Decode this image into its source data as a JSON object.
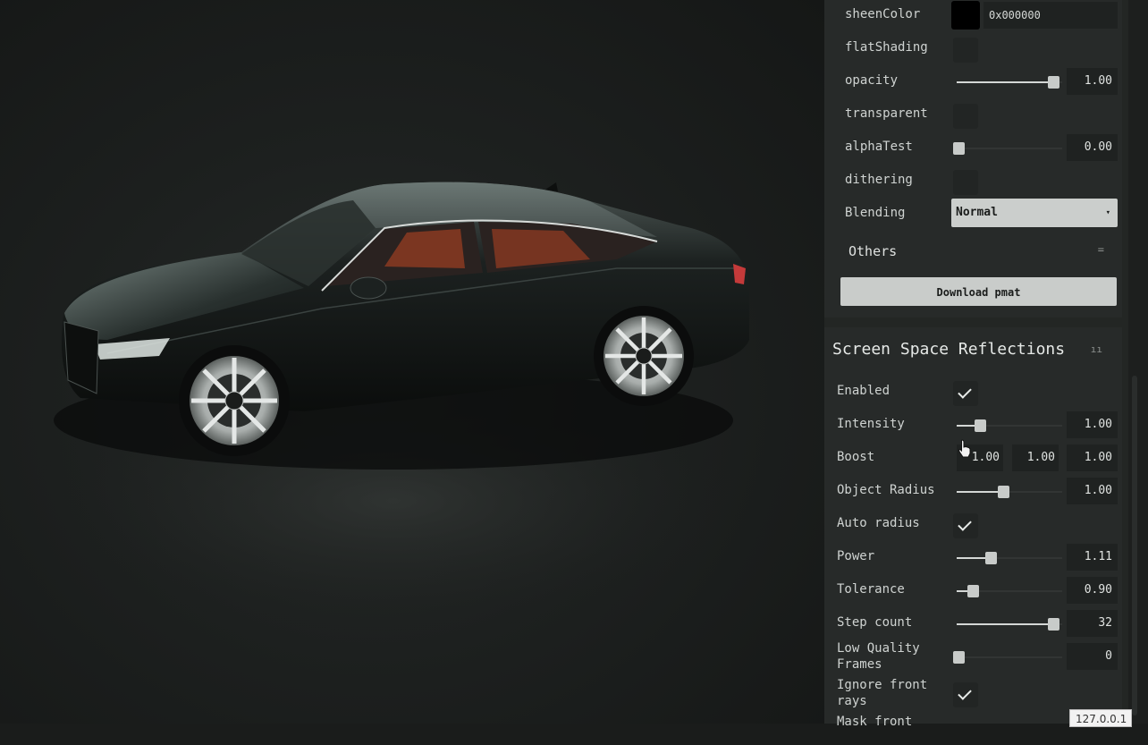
{
  "material": {
    "sheenColor": {
      "label": "sheenColor",
      "value": "0x000000",
      "color": "#000000"
    },
    "flatShading": {
      "label": "flatShading",
      "checked": false
    },
    "opacity": {
      "label": "opacity",
      "value": "1.00",
      "fraction": 1.0
    },
    "transparent": {
      "label": "transparent",
      "checked": false
    },
    "alphaTest": {
      "label": "alphaTest",
      "value": "0.00",
      "fraction": 0.0
    },
    "dithering": {
      "label": "dithering",
      "checked": false
    },
    "blending": {
      "label": "Blending",
      "value": "Normal"
    },
    "others": {
      "label": "Others"
    },
    "download": {
      "label": "Download pmat"
    }
  },
  "ssr": {
    "title": "Screen Space Reflections",
    "enabled": {
      "label": "Enabled",
      "checked": true
    },
    "intensity": {
      "label": "Intensity",
      "value": "1.00",
      "fraction": 0.2
    },
    "boost": {
      "label": "Boost",
      "x": "1.00",
      "y": "1.00",
      "z": "1.00"
    },
    "objectRadius": {
      "label": "Object Radius",
      "value": "1.00",
      "fraction": 0.44
    },
    "autoRadius": {
      "label": "Auto radius",
      "checked": true
    },
    "power": {
      "label": "Power",
      "value": "1.11",
      "fraction": 0.32
    },
    "tolerance": {
      "label": "Tolerance",
      "value": "0.90",
      "fraction": 0.14
    },
    "stepCount": {
      "label": "Step count",
      "value": "32",
      "fraction": 1.0
    },
    "lowQualityFrames": {
      "label": "Low Quality Frames",
      "value": "0",
      "fraction": 0.0
    },
    "ignoreFrontRays": {
      "label": "Ignore front rays",
      "checked": true
    },
    "maskFront": {
      "label": "Mask front"
    }
  },
  "tooltip": {
    "url": "127.0.0.1"
  },
  "colors": {
    "panel_bg": "#272a29",
    "accent": "#c9ccca",
    "car_body": "#111413",
    "interior": "#8a3a22"
  },
  "icons": {
    "cursor": "hand-pointer-icon",
    "checkmark": "checkmark-icon",
    "dropdown": "caret-down-icon",
    "collapse": "collapse-icon"
  }
}
